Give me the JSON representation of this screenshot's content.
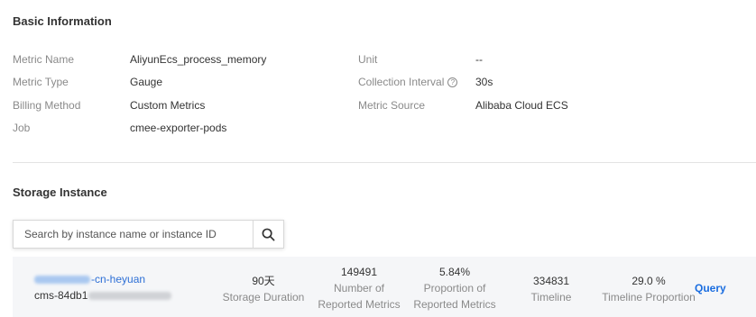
{
  "basic_info": {
    "title": "Basic Information",
    "left": [
      {
        "label": "Metric Name",
        "value": "AliyunEcs_process_memory"
      },
      {
        "label": "Metric Type",
        "value": "Gauge"
      },
      {
        "label": "Billing Method",
        "value": "Custom Metrics"
      },
      {
        "label": "Job",
        "value": "cmee-exporter-pods"
      }
    ],
    "right": [
      {
        "label": "Unit",
        "value": "--"
      },
      {
        "label": "Collection Interval",
        "value": "30s",
        "help_icon": "question-circle-icon"
      },
      {
        "label": "Metric Source",
        "value": "Alibaba Cloud ECS"
      }
    ]
  },
  "storage": {
    "title": "Storage Instance",
    "search": {
      "placeholder": "Search by instance name or instance ID",
      "value": "",
      "icon": "search-icon"
    },
    "row": {
      "instance_name_suffix": "-cn-heyuan",
      "instance_id_prefix": "cms-84db1",
      "storage_duration": {
        "value": "90天",
        "label": "Storage Duration"
      },
      "reported_metrics": {
        "value": "149491",
        "label_line1": "Number of",
        "label_line2": "Reported Metrics"
      },
      "proportion_reported": {
        "value": "5.84%",
        "label_line1": "Proportion of",
        "label_line2": "Reported Metrics"
      },
      "timeline": {
        "value": "334831",
        "label": "Timeline"
      },
      "timeline_proportion": {
        "value": "29.0 %",
        "label": "Timeline Proportion"
      },
      "query_label": "Query"
    }
  },
  "colors": {
    "link": "#2d6fd6",
    "label_gray": "#8a8a8a",
    "row_bg": "#f5f6f8"
  }
}
